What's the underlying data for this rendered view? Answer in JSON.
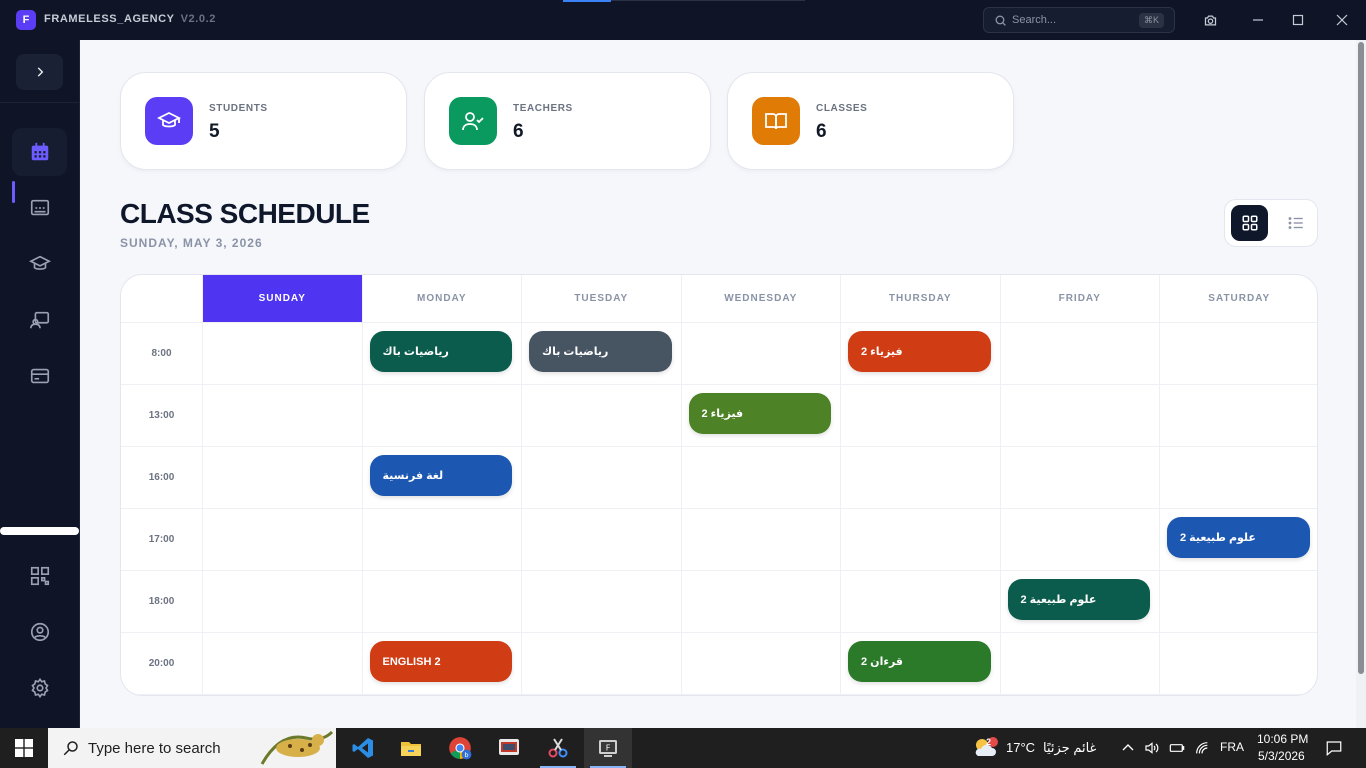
{
  "titlebar": {
    "logo_letter": "F",
    "app_name": "FRAMELESS_AGENCY",
    "version": "V2.0.2",
    "search_placeholder": "Search...",
    "search_shortcut": "⌘K"
  },
  "stats": [
    {
      "label": "STUDENTS",
      "value": "5",
      "color": "#5b3df5",
      "icon": "graduation-cap-icon"
    },
    {
      "label": "TEACHERS",
      "value": "6",
      "color": "#0a9a5f",
      "icon": "user-check-icon"
    },
    {
      "label": "CLASSES",
      "value": "6",
      "color": "#e07b06",
      "icon": "book-open-icon"
    }
  ],
  "schedule": {
    "title": "CLASS SCHEDULE",
    "date": "SUNDAY, MAY 3, 2026",
    "days": [
      "SUNDAY",
      "MONDAY",
      "TUESDAY",
      "WEDNESDAY",
      "THURSDAY",
      "FRIDAY",
      "SATURDAY"
    ],
    "today": "SUNDAY",
    "times": [
      "8:00",
      "13:00",
      "16:00",
      "17:00",
      "18:00",
      "20:00"
    ],
    "events": [
      {
        "day": 1,
        "row": 0,
        "label": "رياضيات باك",
        "color": "#0b5c4c"
      },
      {
        "day": 2,
        "row": 0,
        "label": "رياضيات باك",
        "color": "#475563"
      },
      {
        "day": 4,
        "row": 0,
        "label": "فيزياء 2",
        "color": "#d03c14"
      },
      {
        "day": 3,
        "row": 1,
        "label": "فيزياء 2",
        "color": "#4d8326"
      },
      {
        "day": 1,
        "row": 2,
        "label": "لغة فرنسية",
        "color": "#1c57b2"
      },
      {
        "day": 6,
        "row": 3,
        "label": "علوم طبيعية 2",
        "color": "#1c57b2"
      },
      {
        "day": 5,
        "row": 4,
        "label": "علوم طبيعية 2",
        "color": "#0b5c4c"
      },
      {
        "day": 1,
        "row": 5,
        "label": "ENGLISH 2",
        "color": "#d03c14"
      },
      {
        "day": 4,
        "row": 5,
        "label": "قرءان 2",
        "color": "#2a7a2a"
      }
    ]
  },
  "taskbar": {
    "search_placeholder": "Type here to search",
    "temperature": "17°C",
    "weather": "غائم جزئيًا",
    "weather_badge": "2",
    "language": "FRA",
    "time": "10:06 PM",
    "date": "5/3/2026"
  }
}
